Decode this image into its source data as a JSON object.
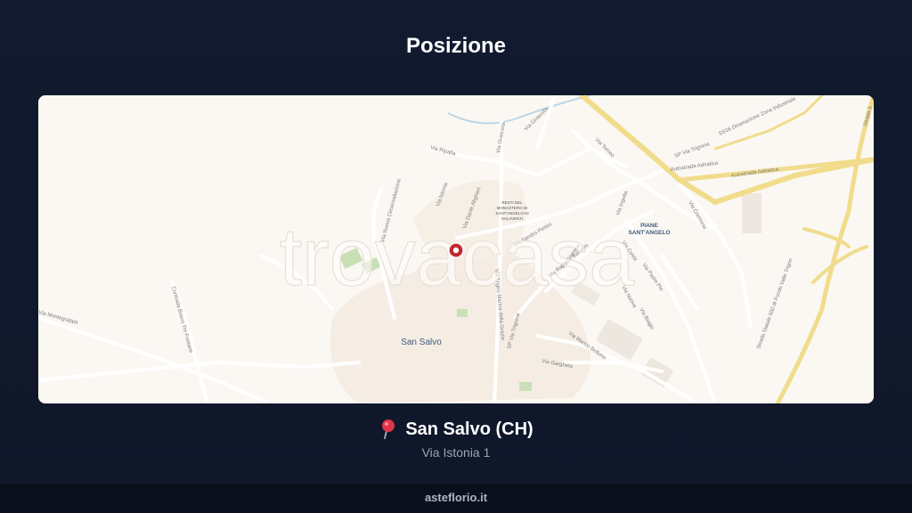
{
  "header": {
    "title": "Posizione"
  },
  "map": {
    "watermark": "trovacasa",
    "labels": {
      "town": "San Salvo",
      "district": "PIANE SANT'ANGELO",
      "district_line1": "PIANE",
      "district_line2": "SANT'ANGELO",
      "monastery_line1": "RESTI DEL",
      "monastery_line2": "MONASTERO DI",
      "monastery_line3": "SANT'ANGELO IN",
      "monastery_line4": "SALAVENTI"
    },
    "roads": [
      "Via Ripalta",
      "Via Grasceta",
      "Via Grasceta",
      "Via Nuova Circonvallazione",
      "Contrada Bosco Tre Fontane",
      "Via Dante Alighieri",
      "Via Sandro Pertini",
      "Via Ingotta",
      "Via Trignina",
      "Via Tomeo",
      "Via Raffaele Sabatini",
      "Via Costa",
      "Via Padre Pio",
      "Via Istonia",
      "Via Trigno Marina della Grazie",
      "SP Via Trignina",
      "Via Montegrappa",
      "Via Manco Belluno",
      "Via Gargheta",
      "Via Biagio",
      "Via Nuova",
      "Via Cremona",
      "Autostrada Adriatica",
      "Autostrada Adriatica",
      "SP Via Trignina",
      "SS16 Diramazione Zona Industriale",
      "Strada Statale 650 di Fondo Valle Trigno",
      "Strada S"
    ],
    "colors": {
      "land": "#fbf8f3",
      "highway": "#f1dc8c",
      "road": "#ffffff",
      "green": "#c9e0b6",
      "water": "#b9d8e6",
      "pin": "#c0262d"
    }
  },
  "location": {
    "icon": "round-pushpin-icon",
    "name": "San Salvo (CH)",
    "address": "Via Istonia 1"
  },
  "footer": {
    "text": "asteflorio.it"
  }
}
